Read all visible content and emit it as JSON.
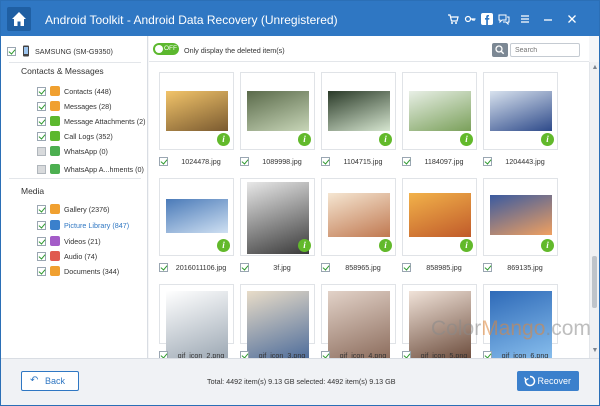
{
  "window": {
    "title": "Android Toolkit - Android Data Recovery (Unregistered)",
    "toolbar_icons": [
      "cart-icon",
      "key-icon",
      "facebook-icon",
      "chat-icon",
      "menu-icon",
      "minimize-icon",
      "close-icon"
    ]
  },
  "sidebar": {
    "device": "SAMSUNG (SM-G9350)",
    "sections": [
      {
        "title": "Contacts & Messages",
        "items": [
          {
            "label": "Contacts (448)",
            "checked": true,
            "icon": "contacts-icon",
            "color": "#f0a030"
          },
          {
            "label": "Messages (28)",
            "checked": true,
            "icon": "messages-icon",
            "color": "#f0a030"
          },
          {
            "label": "Message Attachments (2)",
            "checked": true,
            "icon": "attachment-icon",
            "color": "#5cb82e"
          },
          {
            "label": "Call Logs (352)",
            "checked": true,
            "icon": "call-log-icon",
            "color": "#5cb82e"
          },
          {
            "label": "WhatsApp (0)",
            "checked": false,
            "icon": "whatsapp-icon",
            "color": "#4caf50"
          },
          {
            "label": "WhatsApp A...hments (0)",
            "checked": false,
            "icon": "whatsapp-attachments-icon",
            "color": "#4caf50"
          }
        ]
      },
      {
        "title": "Media",
        "items": [
          {
            "label": "Gallery (2376)",
            "checked": true,
            "icon": "gallery-icon",
            "color": "#f0a030"
          },
          {
            "label": "Picture Library (847)",
            "checked": true,
            "icon": "picture-library-icon",
            "color": "#3b80cc",
            "active": true
          },
          {
            "label": "Videos (21)",
            "checked": true,
            "icon": "video-icon",
            "color": "#a45cc8"
          },
          {
            "label": "Audio (74)",
            "checked": true,
            "icon": "audio-icon",
            "color": "#e05a4f"
          },
          {
            "label": "Documents (344)",
            "checked": true,
            "icon": "documents-icon",
            "color": "#f0a030"
          }
        ]
      }
    ]
  },
  "toolbar": {
    "toggle_state": "OFF",
    "toggle_label": "Only display the deleted item(s)",
    "search_placeholder": "Search"
  },
  "files": [
    {
      "name": "1024478.jpg",
      "colors": [
        "#f2c46a",
        "#7a5a30"
      ]
    },
    {
      "name": "1089998.jpg",
      "colors": [
        "#5a6a4a",
        "#c8d6b8"
      ]
    },
    {
      "name": "1104715.jpg",
      "colors": [
        "#2a3a28",
        "#d6e6d0"
      ]
    },
    {
      "name": "1184097.jpg",
      "colors": [
        "#e8efe6",
        "#7aa05a"
      ]
    },
    {
      "name": "1204443.jpg",
      "colors": [
        "#d8e2ee",
        "#2e4a8a"
      ]
    },
    {
      "name": "2016011106.jpg",
      "colors": [
        "#4a7ab8",
        "#cfe0f2"
      ]
    },
    {
      "name": "3f.jpg",
      "colors": [
        "#e8e8e8",
        "#3a3a3a"
      ]
    },
    {
      "name": "858965.jpg",
      "colors": [
        "#f5e6d2",
        "#c07850"
      ]
    },
    {
      "name": "858985.jpg",
      "colors": [
        "#f2b24a",
        "#c05a2a"
      ]
    },
    {
      "name": "869135.jpg",
      "colors": [
        "#3a5aa0",
        "#f0a060"
      ]
    },
    {
      "name": "gif_icon_2.png",
      "colors": [
        "#ffffff",
        "#9aa6b2"
      ]
    },
    {
      "name": "gif_icon_3.png",
      "colors": [
        "#e8dcc8",
        "#4a6a9a"
      ]
    },
    {
      "name": "gif_icon_4.png",
      "colors": [
        "#e2d2c8",
        "#8a6a5a"
      ]
    },
    {
      "name": "gif_icon_5.png",
      "colors": [
        "#f0e2d8",
        "#6a4a3a"
      ]
    },
    {
      "name": "gif_icon_6.png",
      "colors": [
        "#2e6ab8",
        "#8ac0ee"
      ]
    }
  ],
  "bottom": {
    "back_label": "Back",
    "summary": "Total: 4492 item(s) 9.13 GB   selected: 4492 item(s) 9.13 GB",
    "recover_label": "Recover"
  },
  "watermark": {
    "prefix": "Color",
    "highlight": "Mango",
    "suffix": ".com"
  }
}
